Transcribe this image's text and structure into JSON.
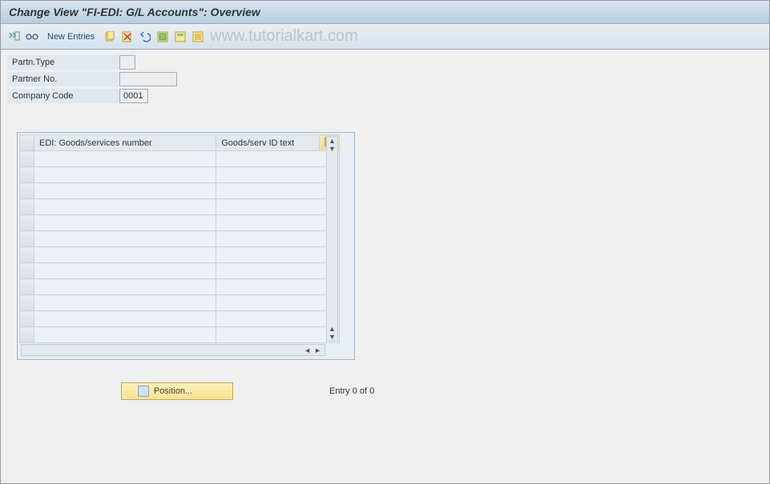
{
  "title": "Change View \"FI-EDI: G/L Accounts\": Overview",
  "toolbar": {
    "new_entries_label": "New Entries"
  },
  "watermark": "www.tutorialkart.com",
  "header": {
    "partn_type_label": "Partn.Type",
    "partn_type_value": "",
    "partner_no_label": "Partner No.",
    "partner_no_value": "",
    "company_code_label": "Company Code",
    "company_code_value": "0001"
  },
  "table": {
    "col1": "EDI: Goods/services number",
    "col2": "Goods/serv ID text",
    "rows": 12
  },
  "footer": {
    "position_label": "Position...",
    "entry_text": "Entry 0 of 0"
  }
}
